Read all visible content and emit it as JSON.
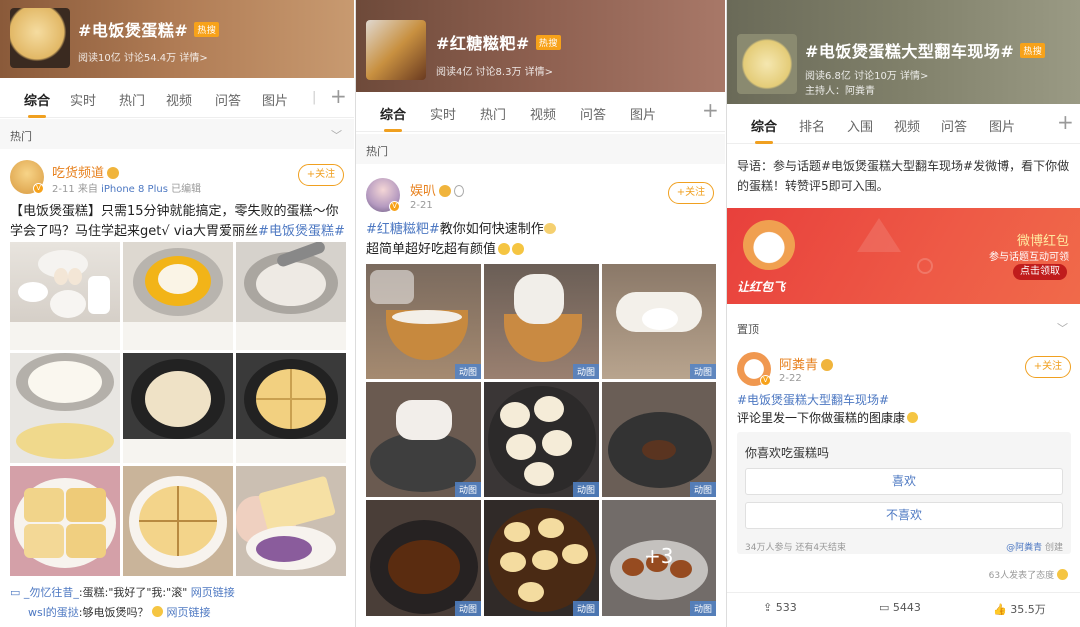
{
  "colors": {
    "accent": "#f0a020",
    "link": "#4d78c2",
    "username": "#e7811e",
    "red_packet": "#e84040"
  },
  "panel1": {
    "topic": {
      "title": "#电饭煲蛋糕#",
      "hot_badge": "热搜",
      "stats": "阅读10亿  讨论54.4万  详情>"
    },
    "tabs": [
      "综合",
      "实时",
      "热门",
      "视频",
      "问答",
      "图片",
      "|"
    ],
    "section": "热门",
    "post": {
      "user": "吃货频道",
      "time": "2-11",
      "source_prefix": "来自",
      "device": "iPhone 8 Plus",
      "edited": "已编辑",
      "follow": "+关注",
      "text": "【电饭煲蛋糕】只需15分钟就能搞定，零失败的蛋糕～你学会了吗？马住学起来get√ via大胃爱丽丝",
      "text_tag": "#电饭煲蛋糕#",
      "images": [
        "eggs-flour",
        "yolk-bowl",
        "whisk-bowl",
        "batter-bowl",
        "batter-pot",
        "cake-cut-pot",
        "cake-slices",
        "cake-quarter",
        "cake-hand"
      ]
    },
    "comments": [
      {
        "user": "_勿忆往昔_",
        "text": ":蛋糕:\"我好了\"我:\"滚\"",
        "link": "网页链接"
      },
      {
        "user": "wsl的蛋挞",
        "text": ":够电饭煲吗？",
        "link": "网页链接"
      }
    ]
  },
  "panel2": {
    "topic": {
      "title": "#红糖糍粑#",
      "hot_badge": "热搜",
      "stats": "阅读4亿  讨论8.3万  详情>"
    },
    "tabs": [
      "综合",
      "实时",
      "热门",
      "视频",
      "问答",
      "图片"
    ],
    "section": "热门",
    "post": {
      "user": "娱叭",
      "time": "2-21",
      "follow": "+关注",
      "tag": "#红糖糍粑#",
      "text1": "教你如何快速制作",
      "text2": "超简单超好吃超有颜值",
      "gif_label": "动图",
      "more": "+3"
    }
  },
  "panel3": {
    "topic": {
      "title": "#电饭煲蛋糕大型翻车现场#",
      "hot_badge": "热搜",
      "stats": "阅读6.8亿  讨论10万  详情>",
      "host": "主持人：阿粪青"
    },
    "tabs": [
      "综合",
      "排名",
      "入围",
      "视频",
      "问答",
      "图片"
    ],
    "guide": "导语：参与话题#电饭煲蛋糕大型翻车现场#发微博，看下你做的蛋糕！转赞评5即可入围。",
    "banner": {
      "title": "微博红包",
      "sub": "参与话题互动可领",
      "button": "点击领取",
      "badge": "让红包飞"
    },
    "section": "置顶",
    "post": {
      "user": "阿粪青",
      "time": "2-22",
      "follow": "+关注",
      "tag": "#电饭煲蛋糕大型翻车现场#",
      "text": "评论里发一下你做蛋糕的图康康",
      "poll": {
        "question": "你喜欢吃蛋糕吗",
        "options": [
          "喜欢",
          "不喜欢"
        ],
        "info": "34万人参与  还有4天结束",
        "creator": "@阿粪青",
        "creator_suffix": " 创建"
      },
      "attitude": "63人发表了态度"
    },
    "actions": {
      "repost": "533",
      "comment": "5443",
      "like": "35.5万"
    }
  }
}
